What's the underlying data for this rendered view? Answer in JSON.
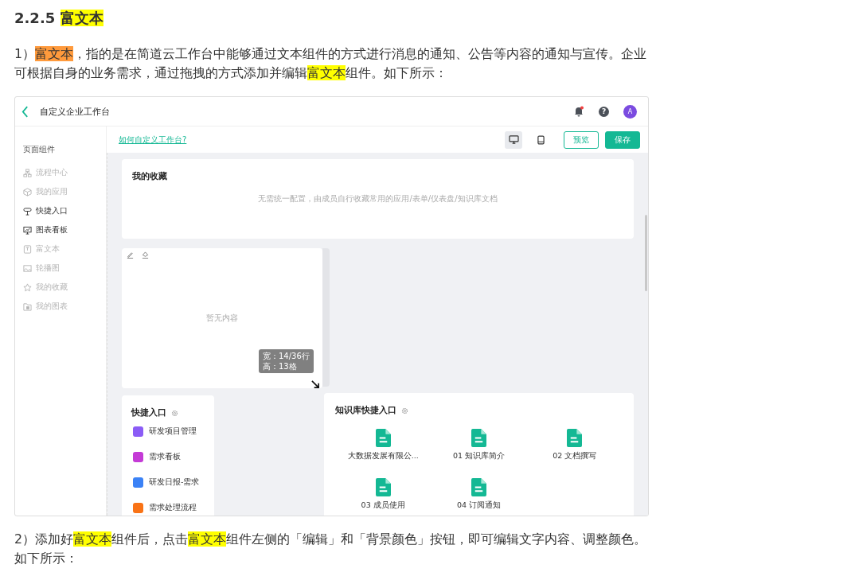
{
  "heading": [
    {
      "text": "2.2.5 "
    },
    {
      "text": "富文本",
      "color": "#ffff00"
    }
  ],
  "intro": [
    {
      "text": "1）"
    },
    {
      "text": "富文本",
      "color": "#ff9a3c"
    },
    {
      "text": "，指的是在简道云工作台中能够通过文本组件的方式进行消息的通知、公告等内容的通知与宣传。企业可根据自身的业务需求，通过拖拽的方式添加并编辑"
    },
    {
      "text": "富文本",
      "color": "#ffff00"
    },
    {
      "text": "组件。如下所示："
    }
  ],
  "screenshot": {
    "title": "自定义企业工作台",
    "has_unread": true,
    "help_icon": "?",
    "avatar": "A",
    "help_link": "如何自定义工作台?",
    "view_modes": [
      {
        "kind": "desktop",
        "selected": true
      },
      {
        "kind": "mobile",
        "selected": false
      }
    ],
    "preview_button": "预览",
    "save_button": "保存",
    "sidebar": {
      "title": "页面组件",
      "items": [
        {
          "kind": "flow",
          "label": "流程中心",
          "disabled": true
        },
        {
          "kind": "cube",
          "label": "我的应用",
          "disabled": true
        },
        {
          "kind": "sign",
          "label": "快捷入口",
          "disabled": false
        },
        {
          "kind": "chart",
          "label": "图表看板",
          "disabled": false
        },
        {
          "kind": "text",
          "label": "富文本",
          "disabled": true
        },
        {
          "kind": "image",
          "label": "轮播图",
          "disabled": true
        },
        {
          "kind": "star",
          "label": "我的收藏",
          "disabled": true
        },
        {
          "kind": "folder",
          "label": "我的图表",
          "disabled": true
        }
      ]
    },
    "favorites": {
      "title": "我的收藏",
      "hint": "无需统一配置，由成员自行收藏常用的应用/表单/仪表盘/知识库文档"
    },
    "rich_text": {
      "empty": "暂无内容",
      "size_lines": [
        "宽：14/36行",
        "高：13格"
      ]
    },
    "quick_entry": {
      "title": "快捷入口",
      "items": [
        {
          "label": "研发项目管理",
          "color": "#8b5cf6"
        },
        {
          "label": "需求看板",
          "color": "#c43bd6"
        },
        {
          "label": "研发日报-需求",
          "color": "#3b82f6"
        },
        {
          "label": "需求处理流程",
          "color": "#f97316"
        }
      ]
    },
    "knowledge": {
      "title": "知识库快捷入口",
      "items": [
        "大数据发展有限公...",
        "01 知识库简介",
        "02 文档撰写",
        "03 成员使用",
        "04 订阅通知"
      ]
    }
  },
  "outro": [
    {
      "text": "2）添加好"
    },
    {
      "text": "富文本",
      "color": "#ffff00"
    },
    {
      "text": "组件后，点击"
    },
    {
      "text": "富文本",
      "color": "#ffff00"
    },
    {
      "text": "组件左侧的「编辑」和「背景颜色」按钮，即可编辑文字内容、调整颜色。如下所示："
    }
  ]
}
